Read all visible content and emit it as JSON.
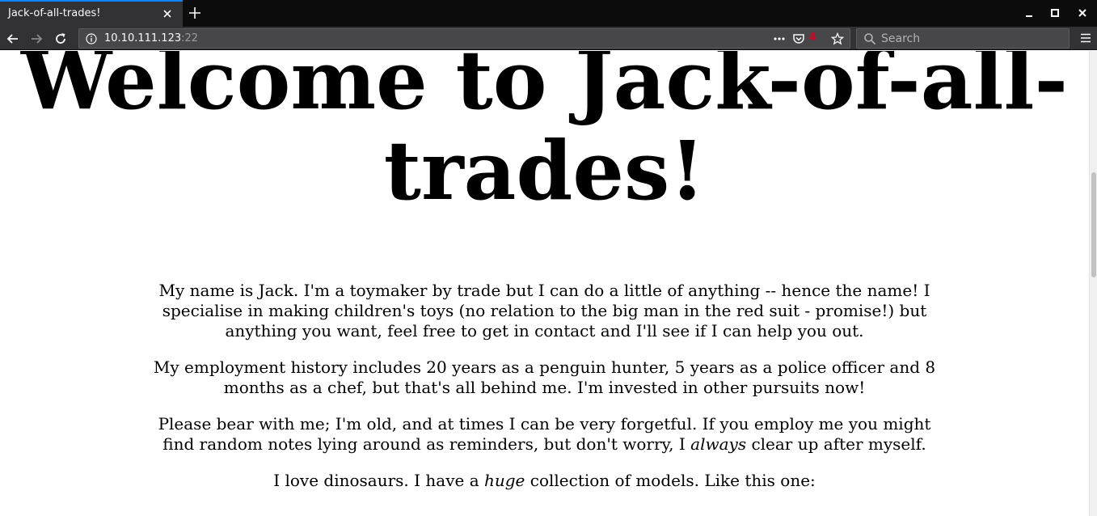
{
  "browser": {
    "tab_title": "Jack-of-all-trades!",
    "url_host": "10.10.111.123",
    "url_port": ":22",
    "pocket_badge": "4",
    "search_placeholder": "Search"
  },
  "page": {
    "heading": "Welcome to Jack-of-all-trades!",
    "paragraphs": {
      "p1": "My name is Jack. I'm a toymaker by trade but I can do a little of anything -- hence the name! I specialise in making children's toys (no relation to the big man in the red suit - promise!) but anything you want, feel free to get in contact and I'll see if I can help you out.",
      "p2": "My employment history includes 20 years as a penguin hunter, 5 years as a police officer and 8 months as a chef, but that's all behind me. I'm invested in other pursuits now!",
      "p3_before": "Please bear with me; I'm old, and at times I can be very forgetful. If you employ me you might find random notes lying around as reminders, but don't worry, I ",
      "p3_em": "always",
      "p3_after": " clear up after myself.",
      "p4_before": "I love dinosaurs. I have a ",
      "p4_em": "huge",
      "p4_after": " collection of models. Like this one:"
    }
  }
}
